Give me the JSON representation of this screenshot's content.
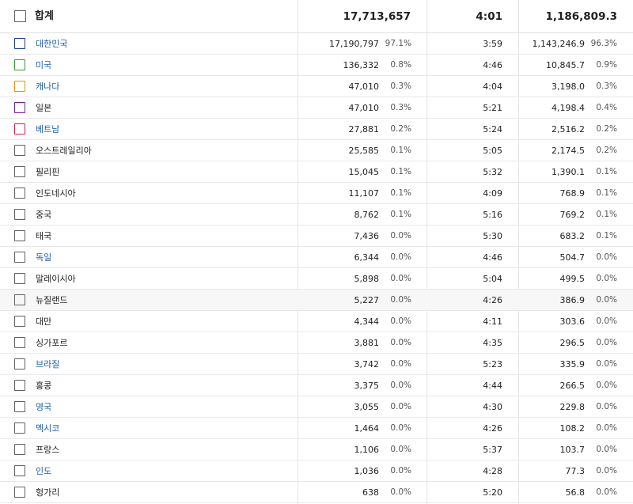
{
  "total": {
    "label": "합계",
    "views": "17,713,657",
    "avg_duration": "4:01",
    "watch_time": "1,186,809.3"
  },
  "rows": [
    {
      "name": "대한민국",
      "link": true,
      "color": "#1a3d8f",
      "views": "17,190,797",
      "views_pct": "97.1%",
      "avg_duration": "3:59",
      "watch_time": "1,143,246.9",
      "watch_pct": "96.3%"
    },
    {
      "name": "미국",
      "link": true,
      "color": "#2e9e2e",
      "views": "136,332",
      "views_pct": "0.8%",
      "avg_duration": "4:46",
      "watch_time": "10,845.7",
      "watch_pct": "0.9%"
    },
    {
      "name": "캐나다",
      "link": true,
      "color": "#e8900c",
      "views": "47,010",
      "views_pct": "0.3%",
      "avg_duration": "4:04",
      "watch_time": "3,198.0",
      "watch_pct": "0.3%"
    },
    {
      "name": "일본",
      "link": false,
      "color": "#7a1fa2",
      "views": "47,010",
      "views_pct": "0.3%",
      "avg_duration": "5:21",
      "watch_time": "4,198.4",
      "watch_pct": "0.4%"
    },
    {
      "name": "베트남",
      "link": true,
      "color": "#d21f4b",
      "views": "27,881",
      "views_pct": "0.2%",
      "avg_duration": "5:24",
      "watch_time": "2,516.2",
      "watch_pct": "0.2%"
    },
    {
      "name": "오스트레일리아",
      "link": false,
      "color": "",
      "views": "25,585",
      "views_pct": "0.1%",
      "avg_duration": "5:05",
      "watch_time": "2,174.5",
      "watch_pct": "0.2%"
    },
    {
      "name": "필리핀",
      "link": false,
      "color": "",
      "views": "15,045",
      "views_pct": "0.1%",
      "avg_duration": "5:32",
      "watch_time": "1,390.1",
      "watch_pct": "0.1%"
    },
    {
      "name": "인도네시아",
      "link": false,
      "color": "",
      "views": "11,107",
      "views_pct": "0.1%",
      "avg_duration": "4:09",
      "watch_time": "768.9",
      "watch_pct": "0.1%"
    },
    {
      "name": "중국",
      "link": false,
      "color": "",
      "views": "8,762",
      "views_pct": "0.1%",
      "avg_duration": "5:16",
      "watch_time": "769.2",
      "watch_pct": "0.1%"
    },
    {
      "name": "태국",
      "link": false,
      "color": "",
      "views": "7,436",
      "views_pct": "0.0%",
      "avg_duration": "5:30",
      "watch_time": "683.2",
      "watch_pct": "0.1%"
    },
    {
      "name": "독일",
      "link": true,
      "color": "",
      "views": "6,344",
      "views_pct": "0.0%",
      "avg_duration": "4:46",
      "watch_time": "504.7",
      "watch_pct": "0.0%"
    },
    {
      "name": "말레이시아",
      "link": false,
      "color": "",
      "views": "5,898",
      "views_pct": "0.0%",
      "avg_duration": "5:04",
      "watch_time": "499.5",
      "watch_pct": "0.0%"
    },
    {
      "name": "뉴질랜드",
      "link": false,
      "color": "",
      "views": "5,227",
      "views_pct": "0.0%",
      "avg_duration": "4:26",
      "watch_time": "386.9",
      "watch_pct": "0.0%",
      "hover": true
    },
    {
      "name": "대만",
      "link": false,
      "color": "",
      "views": "4,344",
      "views_pct": "0.0%",
      "avg_duration": "4:11",
      "watch_time": "303.6",
      "watch_pct": "0.0%"
    },
    {
      "name": "싱가포르",
      "link": false,
      "color": "",
      "views": "3,881",
      "views_pct": "0.0%",
      "avg_duration": "4:35",
      "watch_time": "296.5",
      "watch_pct": "0.0%"
    },
    {
      "name": "브라질",
      "link": true,
      "color": "",
      "views": "3,742",
      "views_pct": "0.0%",
      "avg_duration": "5:23",
      "watch_time": "335.9",
      "watch_pct": "0.0%"
    },
    {
      "name": "홍콩",
      "link": false,
      "color": "",
      "views": "3,375",
      "views_pct": "0.0%",
      "avg_duration": "4:44",
      "watch_time": "266.5",
      "watch_pct": "0.0%"
    },
    {
      "name": "영국",
      "link": true,
      "color": "",
      "views": "3,055",
      "views_pct": "0.0%",
      "avg_duration": "4:30",
      "watch_time": "229.8",
      "watch_pct": "0.0%"
    },
    {
      "name": "멕시코",
      "link": true,
      "color": "",
      "views": "1,464",
      "views_pct": "0.0%",
      "avg_duration": "4:26",
      "watch_time": "108.2",
      "watch_pct": "0.0%"
    },
    {
      "name": "프랑스",
      "link": false,
      "color": "",
      "views": "1,106",
      "views_pct": "0.0%",
      "avg_duration": "5:37",
      "watch_time": "103.7",
      "watch_pct": "0.0%"
    },
    {
      "name": "인도",
      "link": true,
      "color": "",
      "views": "1,036",
      "views_pct": "0.0%",
      "avg_duration": "4:28",
      "watch_time": "77.3",
      "watch_pct": "0.0%"
    },
    {
      "name": "헝가리",
      "link": false,
      "color": "",
      "views": "638",
      "views_pct": "0.0%",
      "avg_duration": "5:20",
      "watch_time": "56.8",
      "watch_pct": "0.0%"
    }
  ]
}
